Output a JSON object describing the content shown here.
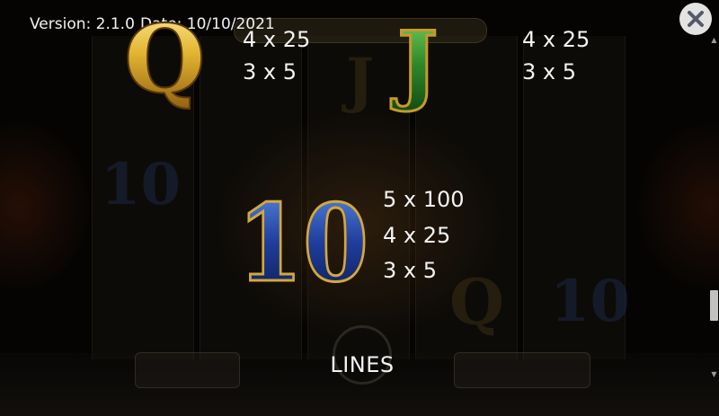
{
  "header": {
    "version": "Version: 2.1.0",
    "date": "Date: 10/10/2021"
  },
  "close_button": {
    "icon": "close-icon"
  },
  "paytable": {
    "symbol_q": {
      "label": "Q",
      "color": "#d9a520",
      "pay_4": "4 x 25",
      "pay_3": "3 x 5"
    },
    "symbol_j": {
      "label": "J",
      "color": "#2f8a2a",
      "pay_4": "4 x 25",
      "pay_3": "3 x 5"
    },
    "symbol_10": {
      "label": "10",
      "color": "#1f3d9a",
      "pay_5": "5 x 100",
      "pay_4": "4 x 25",
      "pay_3": "3 x 5"
    }
  },
  "footer": {
    "lines_label": "LINES"
  },
  "scrollbar": {
    "position": 0.78
  }
}
